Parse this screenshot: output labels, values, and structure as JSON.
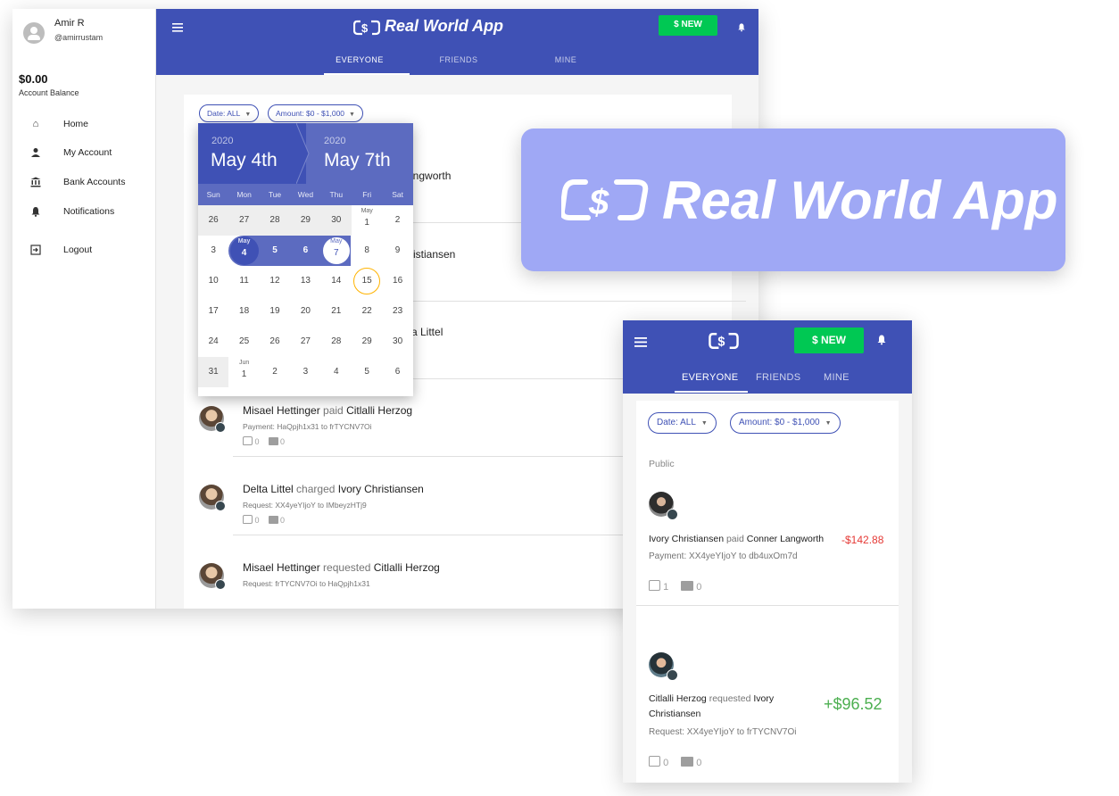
{
  "desktop": {
    "user": {
      "name": "Amir R",
      "handle": "@amirrustam"
    },
    "balance": {
      "amount": "$0.00",
      "label": "Account Balance"
    },
    "nav": [
      {
        "label": "Home",
        "icon": "home-icon"
      },
      {
        "label": "My Account",
        "icon": "person-icon"
      },
      {
        "label": "Bank Accounts",
        "icon": "bank-icon"
      },
      {
        "label": "Notifications",
        "icon": "bell-icon"
      },
      {
        "label": "Logout",
        "icon": "logout-icon"
      }
    ],
    "header": {
      "title": "Real World App",
      "new_button": "$ NEW",
      "tabs": [
        "EVERYONE",
        "FRIENDS",
        "MINE"
      ],
      "active_tab": "EVERYONE"
    },
    "filters": {
      "date": "Date: ALL",
      "amount": "Amount: $0 - $1,000"
    },
    "partial_names": [
      "angworth",
      "ristiansen",
      "a Littel"
    ],
    "calendar": {
      "start": {
        "year": "2020",
        "date": "May 4th"
      },
      "end": {
        "year": "2020",
        "date": "May 7th"
      },
      "weekdays": [
        "Sun",
        "Mon",
        "Tue",
        "Wed",
        "Thu",
        "Fri",
        "Sat"
      ],
      "rows": [
        [
          "26",
          "27",
          "28",
          "29",
          "30",
          "1",
          "2"
        ],
        [
          "3",
          "4",
          "5",
          "6",
          "7",
          "8",
          "9"
        ],
        [
          "10",
          "11",
          "12",
          "13",
          "14",
          "15",
          "16"
        ],
        [
          "17",
          "18",
          "19",
          "20",
          "21",
          "22",
          "23"
        ],
        [
          "24",
          "25",
          "26",
          "27",
          "28",
          "29",
          "30"
        ],
        [
          "31",
          "1",
          "2",
          "3",
          "4",
          "5",
          "6"
        ]
      ],
      "month_labels": {
        "may": "May",
        "jun": "Jun"
      },
      "selected_start": "4",
      "selected_end": "7",
      "today": "15"
    },
    "transactions": [
      {
        "from": "Misael Hettinger",
        "verb": "paid",
        "to": "Citlalli Herzog",
        "detail": "Payment: HaQpjh1x31 to frTYCNV7Oi",
        "likes": "0",
        "comments": "0"
      },
      {
        "from": "Delta Littel",
        "verb": "charged",
        "to": "Ivory Christiansen",
        "detail": "Request: XX4yeYIjoY to IMbeyzHTj9",
        "likes": "0",
        "comments": "0"
      },
      {
        "from": "Misael Hettinger",
        "verb": "requested",
        "to": "Citlalli Herzog",
        "detail": "Request: frTYCNV7Oi to HaQpjh1x31"
      }
    ]
  },
  "banner": {
    "title": "Real World App"
  },
  "mobile": {
    "new_button": "$ NEW",
    "tabs": [
      "EVERYONE",
      "FRIENDS",
      "MINE"
    ],
    "filters": {
      "date": "Date: ALL",
      "amount": "Amount: $0 - $1,000"
    },
    "section": "Public",
    "transactions": [
      {
        "from": "Ivory Christiansen",
        "verb": "paid",
        "to": "Conner Langworth",
        "amount": "-$142.88",
        "detail": "Payment: XX4yeYIjoY to db4uxOm7d",
        "likes": "1",
        "comments": "0"
      },
      {
        "from": "Citlalli Herzog",
        "verb": "requested",
        "to_line1": "Ivory",
        "to_line2": "Christiansen",
        "amount": "+$96.52",
        "detail": "Request: XX4yeYIjoY to frTYCNV7Oi",
        "likes": "0",
        "comments": "0"
      }
    ]
  },
  "colors": {
    "primary": "#3f51b5",
    "new_button": "#00c853",
    "banner": "#9fa8f5",
    "negative": "#e53935",
    "positive": "#4caf50"
  }
}
